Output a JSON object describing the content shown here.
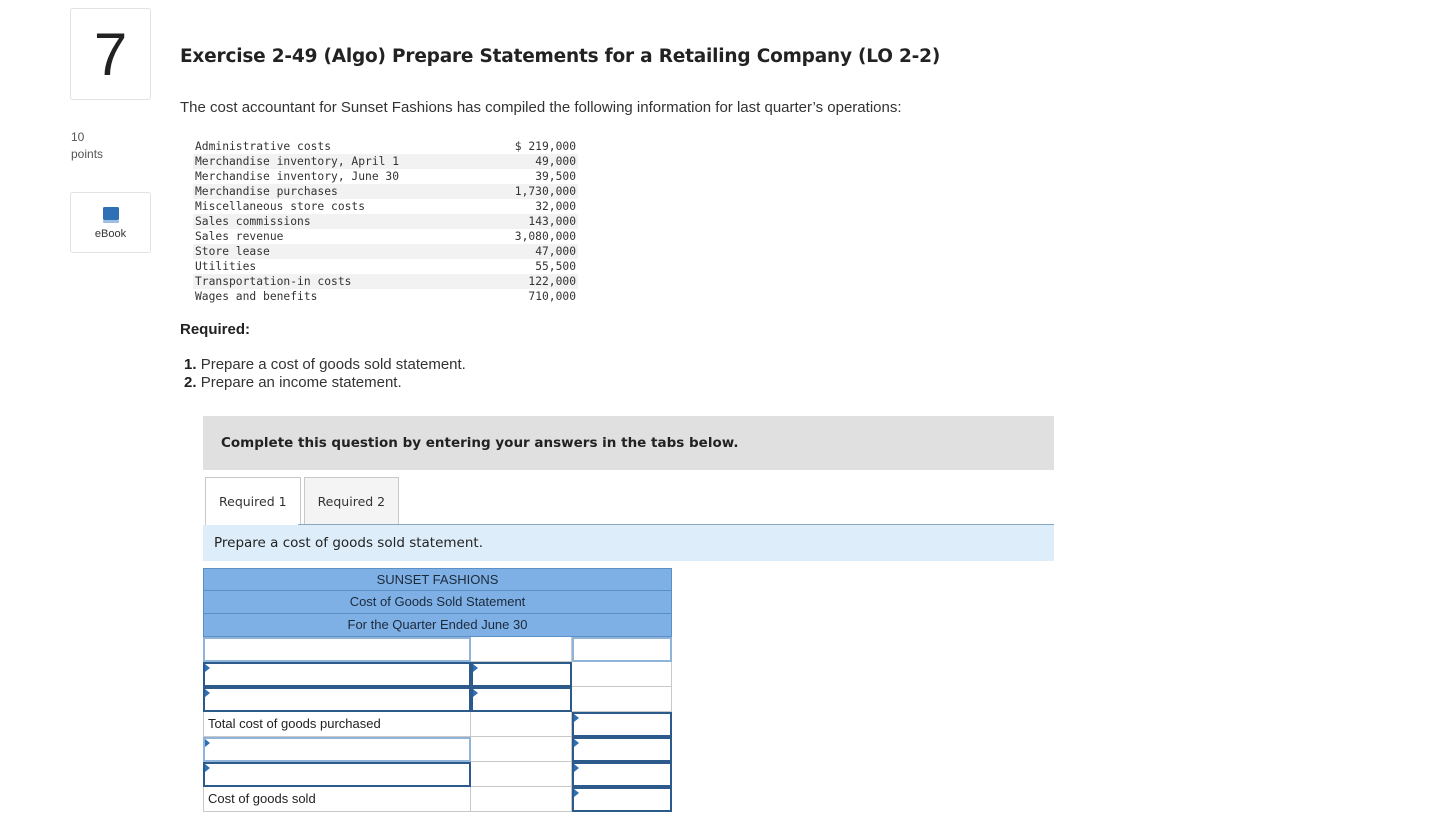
{
  "question": {
    "number": "7",
    "points_value": "10",
    "points_label": "points",
    "ebook_label": "eBook",
    "title": "Exercise 2-49 (Algo) Prepare Statements for a Retailing Company (LO 2-2)",
    "intro": "The cost accountant for Sunset Fashions has compiled the following information for last quarter’s operations:"
  },
  "data_rows": [
    {
      "label": "Administrative costs",
      "value": "$ 219,000"
    },
    {
      "label": "Merchandise inventory, April 1",
      "value": "49,000"
    },
    {
      "label": "Merchandise inventory, June 30",
      "value": "39,500"
    },
    {
      "label": "Merchandise purchases",
      "value": "1,730,000"
    },
    {
      "label": "Miscellaneous store costs",
      "value": "32,000"
    },
    {
      "label": "Sales commissions",
      "value": "143,000"
    },
    {
      "label": "Sales revenue",
      "value": "3,080,000"
    },
    {
      "label": "Store lease",
      "value": "47,000"
    },
    {
      "label": "Utilities",
      "value": "55,500"
    },
    {
      "label": "Transportation-in costs",
      "value": "122,000"
    },
    {
      "label": "Wages and benefits",
      "value": "710,000"
    }
  ],
  "required": {
    "heading": "Required:",
    "items": [
      {
        "num": "1.",
        "text": "Prepare a cost of goods sold statement."
      },
      {
        "num": "2.",
        "text": "Prepare an income statement."
      }
    ]
  },
  "banner": "Complete this question by entering your answers in the tabs below.",
  "tabs": [
    {
      "label": "Required 1",
      "active": true
    },
    {
      "label": "Required 2",
      "active": false
    }
  ],
  "instruction": "Prepare a cost of goods sold statement.",
  "statement": {
    "company": "SUNSET FASHIONS",
    "name": "Cost of Goods Sold Statement",
    "period": "For the Quarter Ended June 30",
    "rows": [
      {
        "label": ""
      },
      {
        "label": ""
      },
      {
        "label": ""
      },
      {
        "label": "Total cost of goods purchased"
      },
      {
        "label": ""
      },
      {
        "label": ""
      },
      {
        "label": "Cost of goods sold"
      }
    ]
  },
  "colors": {
    "header_blue": "#7eb0e6",
    "instruction_bg": "#ddeefa",
    "banner_bg": "#e0e0e0",
    "input_marker": "#2f6fb6"
  }
}
